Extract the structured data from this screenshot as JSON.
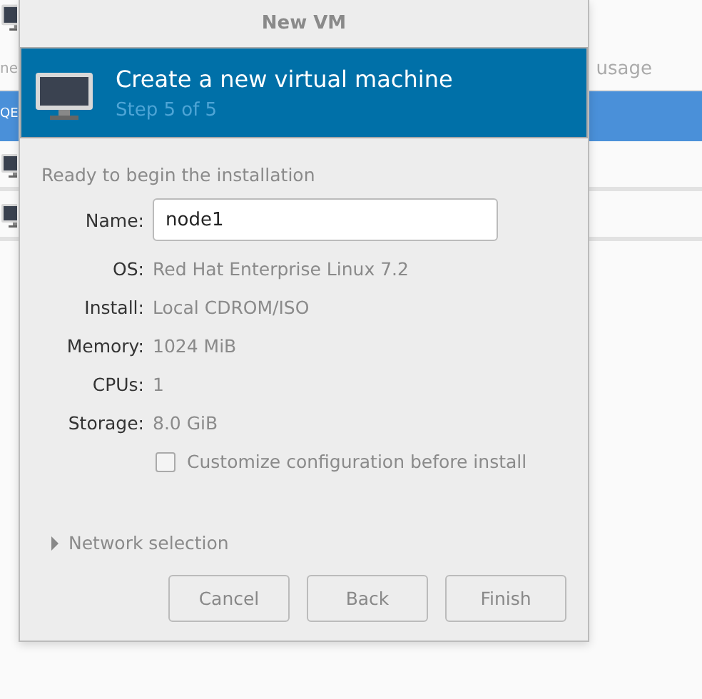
{
  "background_window": {
    "columns": [
      "ne",
      "usage"
    ],
    "rows": [
      {
        "name": "QE",
        "selected": true
      },
      {
        "selected": false
      },
      {
        "selected": false
      }
    ]
  },
  "dialog": {
    "title": "New VM",
    "banner": {
      "title": "Create a new virtual machine",
      "step": "Step 5 of 5"
    },
    "section": "Ready to begin the installation",
    "name_field": {
      "label": "Name:",
      "value": "node1"
    },
    "details": [
      {
        "label": "OS:",
        "value": "Red Hat Enterprise Linux 7.2"
      },
      {
        "label": "Install:",
        "value": "Local CDROM/ISO"
      },
      {
        "label": "Memory:",
        "value": "1024 MiB"
      },
      {
        "label": "CPUs:",
        "value": "1"
      },
      {
        "label": "Storage:",
        "value": "8.0 GiB"
      }
    ],
    "customize": {
      "label": "Customize configuration before install",
      "checked": false
    },
    "network": {
      "label": "Network selection",
      "expanded": false
    },
    "buttons": [
      "Cancel",
      "Back",
      "Finish"
    ]
  }
}
